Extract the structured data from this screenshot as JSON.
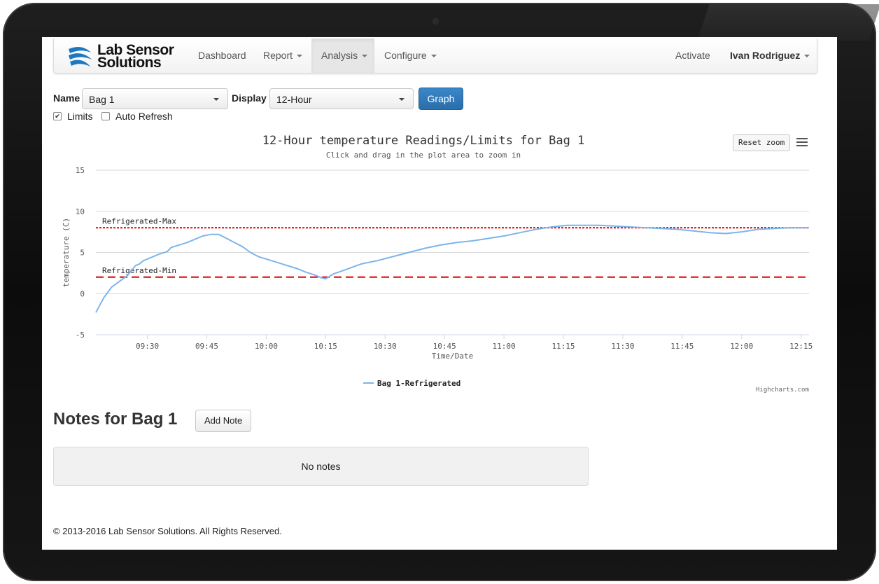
{
  "app": {
    "brand_line1": "Lab Sensor",
    "brand_line2": "Solutions",
    "accent_color": "#2a6eaa"
  },
  "nav": {
    "items": [
      {
        "label": "Dashboard",
        "has_caret": false
      },
      {
        "label": "Report",
        "has_caret": true
      },
      {
        "label": "Analysis",
        "has_caret": true,
        "active": true
      },
      {
        "label": "Configure",
        "has_caret": true
      }
    ],
    "activate": "Activate",
    "user": "Ivan Rodriguez"
  },
  "controls": {
    "name_label": "Name",
    "name_value": "Bag 1",
    "display_label": "Display",
    "display_value": "12-Hour",
    "graph_button": "Graph",
    "limits_label": "Limits",
    "limits_checked": true,
    "auto_refresh_label": "Auto Refresh",
    "auto_refresh_checked": false
  },
  "chart": {
    "reset_zoom": "Reset zoom",
    "menu_icon": "hamburger-menu-icon",
    "credits": "Highcharts.com"
  },
  "chart_data": {
    "type": "line",
    "title": "12-Hour temperature Readings/Limits for Bag 1",
    "subtitle": "Click and drag in the plot area to zoom in",
    "xlabel": "Time/Date",
    "ylabel": "temperature (C)",
    "ylim": [
      -5,
      15
    ],
    "yticks": [
      15,
      10,
      5,
      0,
      -5
    ],
    "xticks": [
      "09:30",
      "09:45",
      "10:00",
      "10:15",
      "10:30",
      "10:45",
      "11:00",
      "11:15",
      "11:30",
      "11:45",
      "12:00",
      "12:15"
    ],
    "xlim": [
      "09:17",
      "12:17"
    ],
    "grid": true,
    "legend_position": "bottom-center",
    "series": [
      {
        "name": "Bag 1-Refrigerated",
        "color": "#7cb5ec",
        "x": [
          "09:17",
          "09:19",
          "09:21",
          "09:23",
          "09:25",
          "09:26",
          "09:27",
          "09:28",
          "09:29",
          "09:31",
          "09:33",
          "09:35",
          "09:36",
          "09:38",
          "09:40",
          "09:42",
          "09:44",
          "09:46",
          "09:48",
          "09:50",
          "09:52",
          "09:54",
          "09:56",
          "09:58",
          "10:00",
          "10:02",
          "10:04",
          "10:06",
          "10:08",
          "10:10",
          "10:12",
          "10:14",
          "10:15",
          "10:17",
          "10:20",
          "10:24",
          "10:28",
          "10:32",
          "10:36",
          "10:40",
          "10:44",
          "10:48",
          "10:52",
          "10:56",
          "11:00",
          "11:04",
          "11:08",
          "11:12",
          "11:16",
          "11:20",
          "11:24",
          "11:28",
          "11:32",
          "11:36",
          "11:40",
          "11:44",
          "11:48",
          "11:52",
          "11:56",
          "12:00",
          "12:04",
          "12:08",
          "12:12",
          "12:17"
        ],
        "values": [
          -2.3,
          -0.5,
          0.8,
          1.5,
          2.2,
          2.8,
          3.4,
          3.6,
          4.0,
          4.4,
          4.8,
          5.1,
          5.6,
          5.9,
          6.2,
          6.6,
          7.0,
          7.2,
          7.2,
          6.7,
          6.2,
          5.7,
          5.0,
          4.5,
          4.2,
          3.9,
          3.6,
          3.3,
          3.0,
          2.6,
          2.3,
          1.9,
          1.8,
          2.4,
          2.9,
          3.6,
          4.0,
          4.5,
          5.0,
          5.5,
          5.9,
          6.2,
          6.4,
          6.7,
          7.0,
          7.4,
          7.8,
          8.1,
          8.3,
          8.3,
          8.3,
          8.2,
          8.1,
          8.0,
          7.9,
          7.8,
          7.6,
          7.4,
          7.3,
          7.5,
          7.8,
          7.9,
          8.0,
          8.0
        ]
      }
    ],
    "plot_lines": [
      {
        "label": "Refrigerated-Max",
        "value": 8.0,
        "style": "dotted",
        "color": "#e00000"
      },
      {
        "label": "Refrigerated-Min",
        "value": 2.0,
        "style": "dashed",
        "color": "#e00000"
      }
    ]
  },
  "notes": {
    "title": "Notes for Bag 1",
    "add_button": "Add Note",
    "empty_text": "No notes"
  },
  "footer": {
    "copyright": "© 2013-2016 Lab Sensor Solutions. All Rights Reserved."
  }
}
